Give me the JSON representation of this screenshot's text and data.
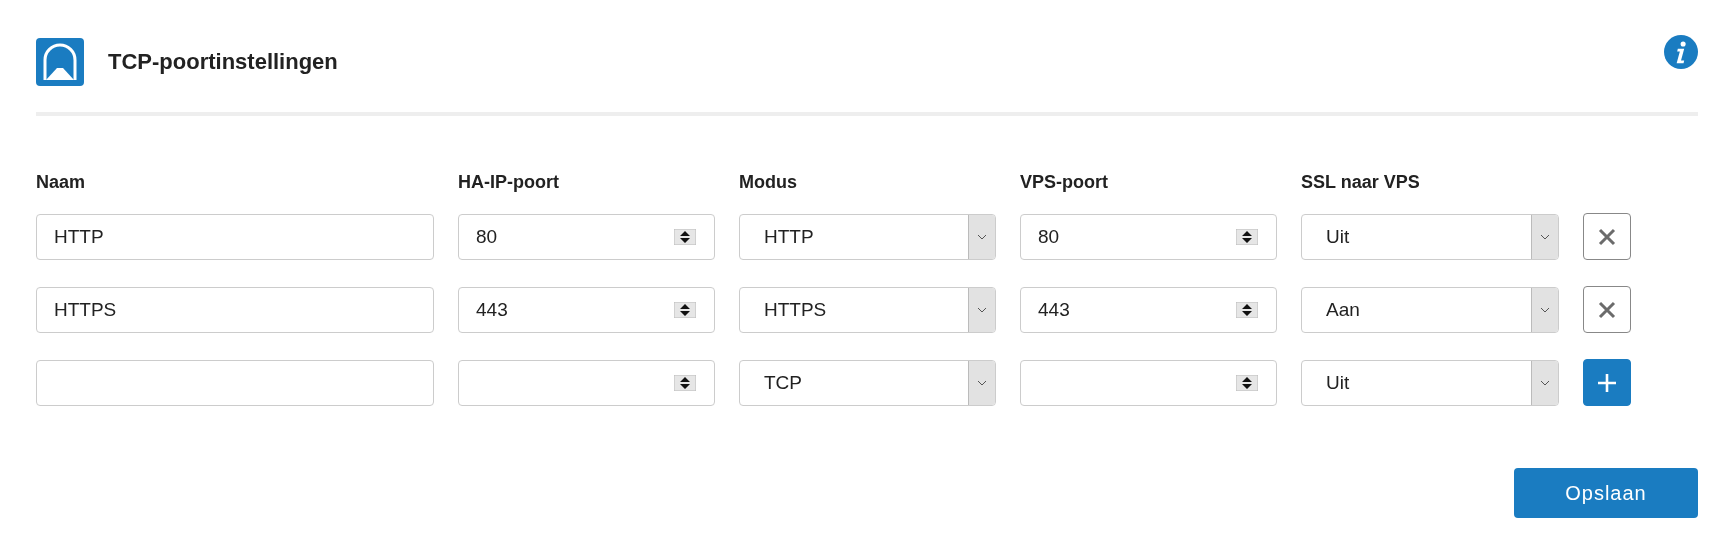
{
  "header": {
    "title": "TCP-poortinstellingen"
  },
  "columns": [
    "Naam",
    "HA-IP-poort",
    "Modus",
    "VPS-poort",
    "SSL naar VPS"
  ],
  "rows": [
    {
      "name": "HTTP",
      "ha_port": "80",
      "mode": "HTTP",
      "vps_port": "80",
      "ssl": "Uit",
      "kind": "delete"
    },
    {
      "name": "HTTPS",
      "ha_port": "443",
      "mode": "HTTPS",
      "vps_port": "443",
      "ssl": "Aan",
      "kind": "delete"
    },
    {
      "mode": "TCP",
      "ssl": "Uit",
      "kind": "add"
    }
  ],
  "save_button": "Opslaan"
}
